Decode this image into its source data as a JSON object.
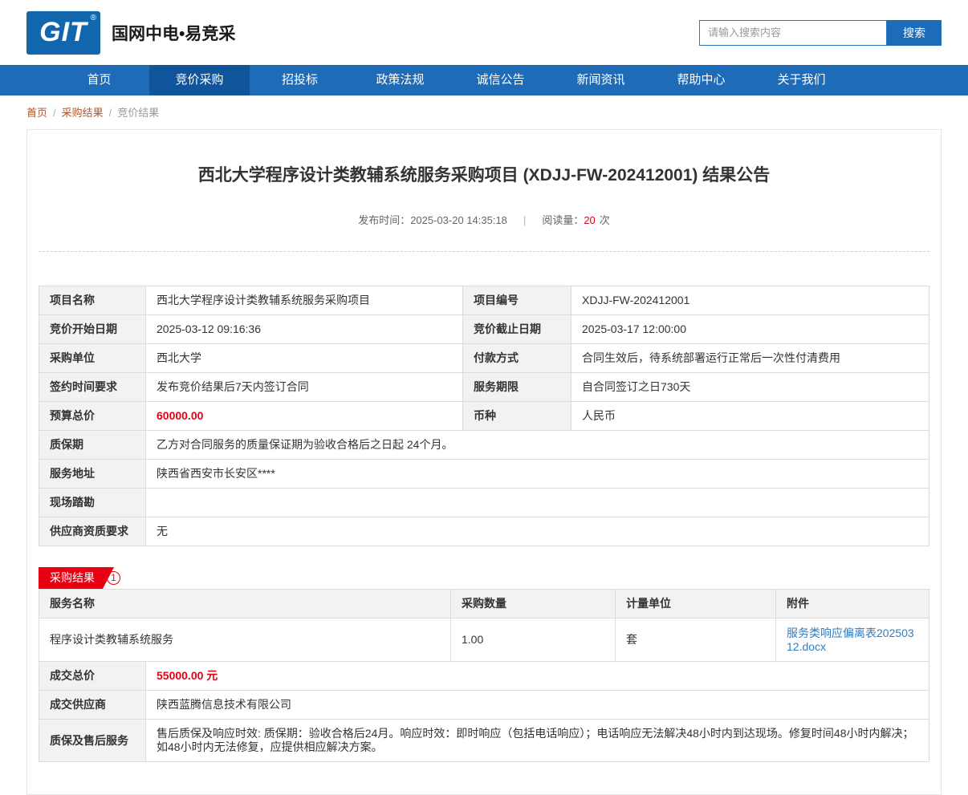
{
  "colors": {
    "nav_blue": "#1e6bb8",
    "nav_active_blue": "#10549c",
    "logo_blue": "#1266ad",
    "accent_red": "#e60012",
    "breadcrumb_link": "#b4562e",
    "attachment_link_blue": "#2f7dc2",
    "label_bg": "#f2f2f2",
    "table_border": "#dcdcdc"
  },
  "header": {
    "logo_text": "GIT",
    "logo_reg": "®",
    "site_name": "国网中电•易竞采",
    "search_placeholder": "请输入搜索内容",
    "search_button": "搜索"
  },
  "nav": {
    "items": [
      {
        "label": "首页"
      },
      {
        "label": "竞价采购"
      },
      {
        "label": "招投标"
      },
      {
        "label": "政策法规"
      },
      {
        "label": "诚信公告"
      },
      {
        "label": "新闻资讯"
      },
      {
        "label": "帮助中心"
      },
      {
        "label": "关于我们"
      }
    ],
    "active_index": 1
  },
  "breadcrumb": {
    "items": [
      "首页",
      "采购结果",
      "竞价结果"
    ],
    "separator": "/"
  },
  "article": {
    "title": "西北大学程序设计类教辅系统服务采购项目 (XDJJ-FW-202412001) 结果公告",
    "publish_label": "发布时间：",
    "publish_time": "2025-03-20 14:35:18",
    "meta_separator": "|",
    "views_label": "阅读量：",
    "views_count": "20",
    "views_unit": "次"
  },
  "info_table": {
    "pair_rows": [
      {
        "l1": "项目名称",
        "v1": "西北大学程序设计类教辅系统服务采购项目",
        "l2": "项目编号",
        "v2": "XDJJ-FW-202412001"
      },
      {
        "l1": "竞价开始日期",
        "v1": "2025-03-12 09:16:36",
        "l2": "竞价截止日期",
        "v2": "2025-03-17 12:00:00"
      },
      {
        "l1": "采购单位",
        "v1": "西北大学",
        "l2": "付款方式",
        "v2": "合同生效后，待系统部署运行正常后一次性付清费用"
      },
      {
        "l1": "签约时间要求",
        "v1": "发布竞价结果后7天内签订合同",
        "l2": "服务期限",
        "v2": "自合同签订之日730天"
      },
      {
        "l1": "预算总价",
        "v1": "60000.00",
        "l2": "币种",
        "v2": "人民币"
      }
    ],
    "full_rows": [
      {
        "l": "质保期",
        "v": "乙方对合同服务的质量保证期为验收合格后之日起 24个月。"
      },
      {
        "l": "服务地址",
        "v": "陕西省西安市长安区****"
      },
      {
        "l": "现场踏勘",
        "v": ""
      },
      {
        "l": "供应商资质要求",
        "v": "无"
      }
    ]
  },
  "result": {
    "ribbon_label": "采购结果",
    "ribbon_badge": "1",
    "headers": [
      "服务名称",
      "采购数量",
      "计量单位",
      "附件"
    ],
    "rows": [
      {
        "name": "程序设计类教辅系统服务",
        "quantity": "1.00",
        "unit": "套",
        "attachment": "服务类响应偏离表20250312.docx"
      }
    ],
    "summary": [
      {
        "label": "成交总价",
        "value": "55000.00 元"
      },
      {
        "label": "成交供应商",
        "value": "陕西蓝腾信息技术有限公司"
      },
      {
        "label": "质保及售后服务",
        "value": "售后质保及响应时效: 质保期：验收合格后24月。响应时效：即时响应（包括电话响应）；电话响应无法解决48小时内到达现场。修复时间48小时内解决；如48小时内无法修复，应提供相应解决方案。"
      }
    ]
  }
}
